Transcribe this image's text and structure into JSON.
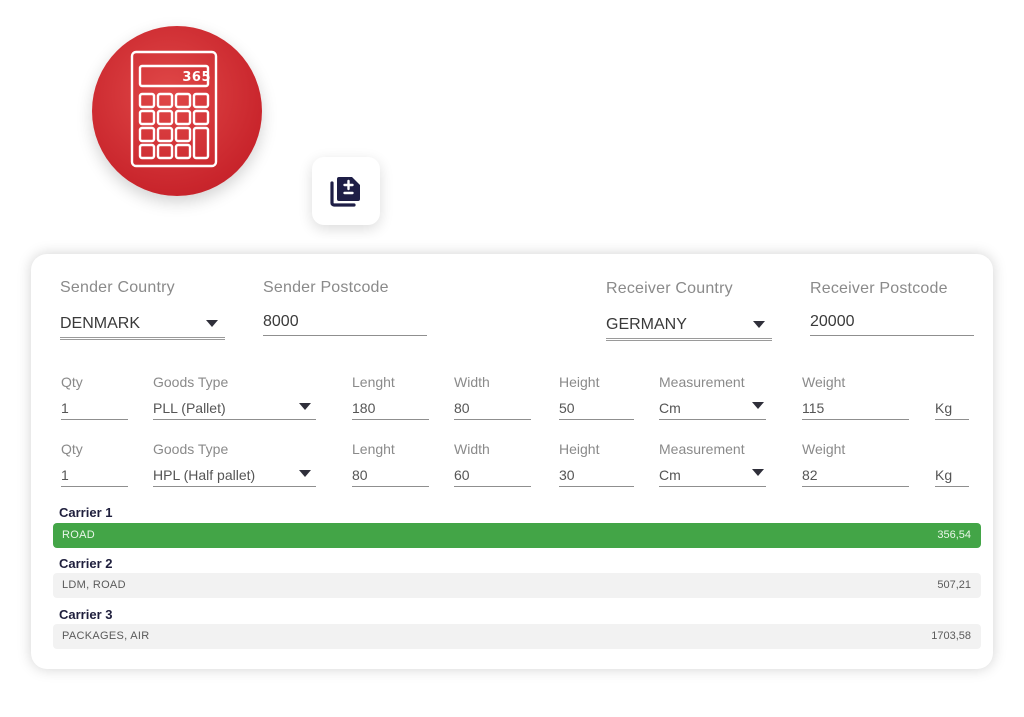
{
  "calculator": {
    "display": "365",
    "icon": "calculator-icon",
    "color": "#c9252c"
  },
  "copy_button": {
    "icon": "copy-plus-minus-icon",
    "color": "#1e1e46"
  },
  "route": {
    "sender_country_label": "Sender Country",
    "sender_country": "DENMARK",
    "sender_postcode_label": "Sender Postcode",
    "sender_postcode": "8000",
    "receiver_country_label": "Receiver Country",
    "receiver_country": "GERMANY",
    "receiver_postcode_label": "Receiver Postcode",
    "receiver_postcode": "20000"
  },
  "goods_rows": [
    {
      "qty_label": "Qty",
      "qty": "1",
      "type_label": "Goods Type",
      "type": "PLL (Pallet)",
      "length_label": "Lenght",
      "length": "180",
      "width_label": "Width",
      "width": "80",
      "height_label": "Height",
      "height": "50",
      "measure_label": "Measurement",
      "measure": "Cm",
      "weight_label": "Weight",
      "weight": "115",
      "weight_unit": "Kg"
    },
    {
      "qty_label": "Qty",
      "qty": "1",
      "type_label": "Goods Type",
      "type": "HPL (Half pallet)",
      "length_label": "Lenght",
      "length": "80",
      "width_label": "Width",
      "width": "60",
      "height_label": "Height",
      "height": "30",
      "measure_label": "Measurement",
      "measure": "Cm",
      "weight_label": "Weight",
      "weight": "82",
      "weight_unit": "Kg"
    }
  ],
  "carriers": [
    {
      "title": "Carrier 1",
      "services": "ROAD",
      "price": "356,54",
      "best": true
    },
    {
      "title": "Carrier 2",
      "services": "LDM, ROAD",
      "price": "507,21",
      "best": false
    },
    {
      "title": "Carrier 3",
      "services": "PACKAGES, AIR",
      "price": "1703,58",
      "best": false
    }
  ],
  "colors": {
    "best_price": "#43a547",
    "dark_text": "#1e1e3c"
  }
}
